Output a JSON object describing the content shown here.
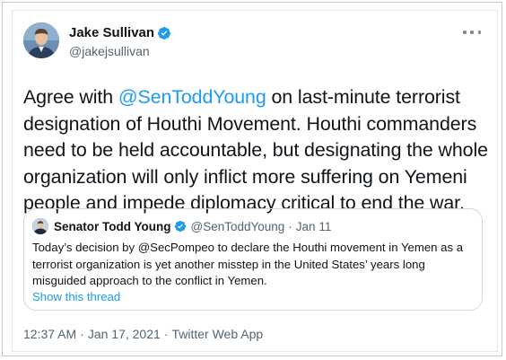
{
  "tweet": {
    "author_name": "Jake Sullivan",
    "author_handle": "@jakejsullivan",
    "text_before_mention": "Agree with ",
    "mention": "@SenToddYoung",
    "text_after_mention": " on last-minute terrorist designation of Houthi Movement. Houthi commanders need to be held accountable, but designating the whole organization will only inflict more suffering on Yemeni people and impede diplomacy critical to end the war.",
    "time": "12:37 AM",
    "date": "Jan 17, 2021",
    "source": "Twitter Web App",
    "separator": "·"
  },
  "quote": {
    "author_name": "Senator Todd Young",
    "author_handle": "@SenToddYoung",
    "separator": "·",
    "date": "Jan 11",
    "text": "Today’s decision by @SecPompeo to declare the Houthi movement in Yemen as a terrorist organization is yet another misstep in the United States’ years long misguided approach to the conflict in Yemen.",
    "show_thread_label": "Show this thread"
  },
  "icons": {
    "verified": "verified-badge-icon",
    "more": "more-options-icon"
  },
  "colors": {
    "link": "#1d9bf0",
    "secondary_text": "#536471",
    "primary_text": "#0f1419",
    "verified_badge": "#1d9bf0"
  }
}
